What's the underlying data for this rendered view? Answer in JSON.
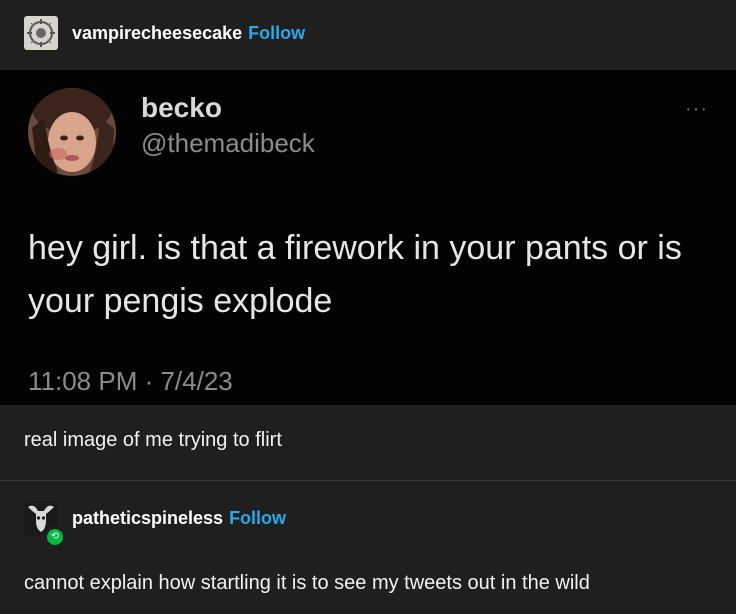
{
  "post": {
    "author": {
      "username": "vampirecheesecake",
      "follow_label": "Follow",
      "avatar_icon": "ornate-emblem-icon"
    },
    "tweet": {
      "name": "becko",
      "handle": "@themadibeck",
      "more_icon": "more-options-icon",
      "more_glyph": "···",
      "text": "hey girl. is that a firework in your pants or is your pengis explode",
      "timestamp": "11:08 PM · 7/4/23"
    },
    "caption": "real image of me trying to flirt"
  },
  "reblog": {
    "username": "patheticspineless",
    "follow_label": "Follow",
    "avatar_icon": "goat-skull-icon",
    "badge_icon": "reblog-icon",
    "badge_glyph": "⟲",
    "text": "cannot explain how startling it is to see my tweets out in the wild"
  },
  "colors": {
    "background": "#1f1f1f",
    "follow": "#2aa8ea",
    "reblog_badge": "#00b93f",
    "tweet_background": "#030303"
  }
}
